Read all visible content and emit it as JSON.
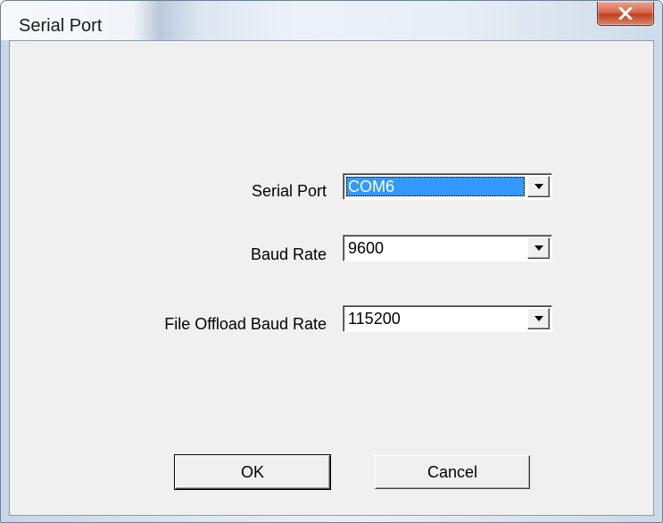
{
  "window": {
    "title": "Serial Port",
    "close_icon": "close-x-icon"
  },
  "form": {
    "serial_port": {
      "label": "Serial Port",
      "value": "COM6",
      "arrow_icon": "dropdown-arrow-icon"
    },
    "baud_rate": {
      "label": "Baud Rate",
      "value": "9600",
      "arrow_icon": "dropdown-arrow-icon"
    },
    "offload_baud_rate": {
      "label": "File Offload Baud Rate",
      "value": "115200",
      "arrow_icon": "dropdown-arrow-icon"
    }
  },
  "buttons": {
    "ok": "OK",
    "cancel": "Cancel"
  },
  "colors": {
    "selection": "#3399ff",
    "close_button": "#c2401f",
    "dialog_face": "#f0f0f0"
  }
}
